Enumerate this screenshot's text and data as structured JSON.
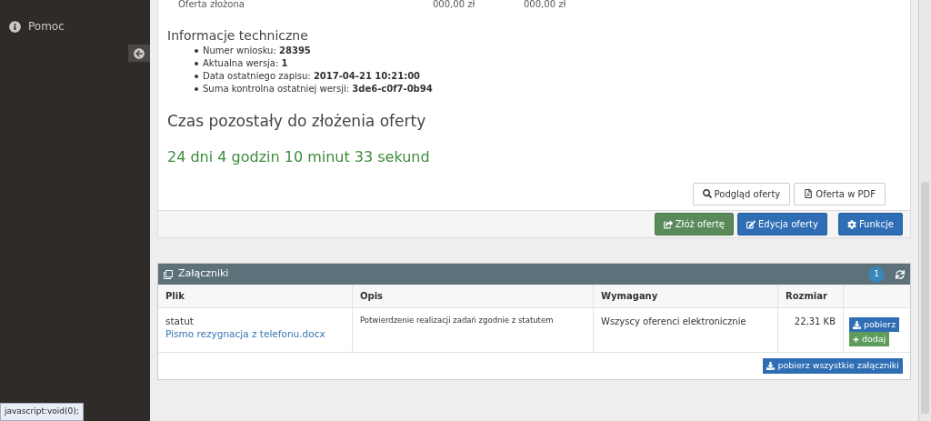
{
  "sidebar": {
    "items": [
      {
        "label": "Pomoc",
        "kind": "info"
      }
    ]
  },
  "offer_row": {
    "label": "Oferta złożona",
    "column_2": "000,00 zł",
    "column_3": "000,00 zł"
  },
  "tech_info": {
    "title": "Informacje techniczne",
    "items": [
      {
        "label": "Numer wniosku:",
        "value": "28395"
      },
      {
        "label": "Aktualna wersja:",
        "value": "1"
      },
      {
        "label": "Data ostatniego zapisu:",
        "value": "2017-04-21 10:21:00"
      },
      {
        "label": "Suma kontrolna ostatniej wersji:",
        "value": "3de6-c0f7-0b94"
      }
    ]
  },
  "countdown": {
    "title": "Czas pozostały do złożenia oferty",
    "value": "24 dni 4 godzin 10 minut 33 sekund"
  },
  "view_buttons": [
    {
      "label": "Podgląd oferty",
      "kind": "search"
    },
    {
      "label": "Oferta w PDF",
      "kind": "pdf"
    }
  ],
  "action_buttons": [
    {
      "label": "Złóż ofertę",
      "kind": "submit"
    },
    {
      "label": "Edycja oferty",
      "kind": "edit"
    },
    {
      "label": "Funkcje",
      "kind": "gear"
    }
  ],
  "attachments": {
    "title": "Załączniki",
    "count": "1",
    "columns": [
      "Plik",
      "Opis",
      "Wymagany",
      "Rozmiar"
    ],
    "rows": [
      {
        "name": "statut",
        "file": "Pismo rezygnacja z telefonu.docx",
        "description": "Potwierdzenie realizacji zadań zgodnie z statutem",
        "required": "Wszyscy oferenci elektronicznie",
        "size": "22,31 KB",
        "download": "pobierz",
        "add": "dodaj"
      }
    ],
    "download_all": "pobierz wszystkie załączniki"
  },
  "status_bar": "javascript:void(0);"
}
